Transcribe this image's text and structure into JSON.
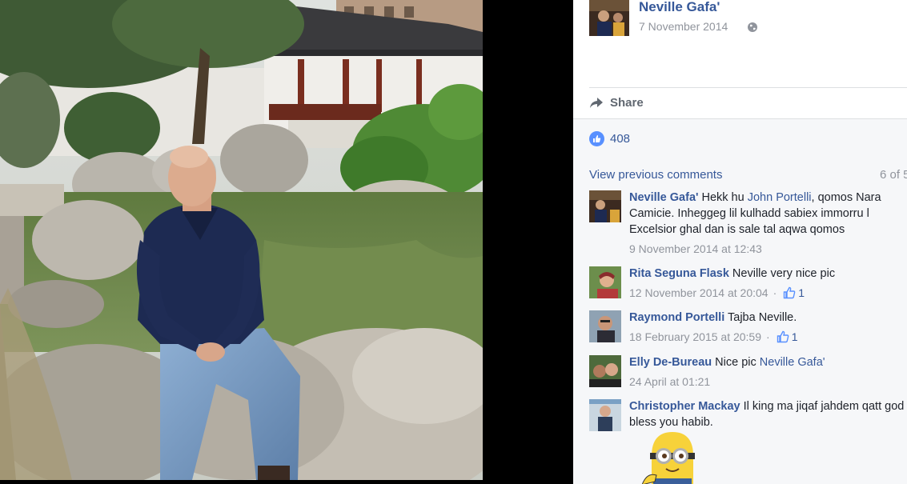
{
  "post": {
    "author": "Neville Gafa'",
    "date": "7 November 2014",
    "share_label": "Share",
    "likes_count": "408"
  },
  "comments": {
    "view_previous_label": "View previous comments",
    "count_label": "6 of 5",
    "items": [
      {
        "author": "Neville Gafa'",
        "text_before": " Hekk hu ",
        "link": "John Portelli",
        "text_after": ", qomos Nara Camicie. Inheggeg lil kulhadd sabiex immorru l Excelsior ghal dan is sale tal aqwa qomos",
        "timestamp": "9 November 2014 at 12:43"
      },
      {
        "author": "Rita Seguna Flask",
        "text_before": " Neville very nice pic",
        "timestamp": "12 November 2014 at 20:04",
        "likes": "1"
      },
      {
        "author": "Raymond Portelli",
        "text_before": " Tajba Neville.",
        "timestamp": "18 February 2015 at 20:59",
        "likes": "1"
      },
      {
        "author": "Elly De-Bureau",
        "text_before": " Nice pic ",
        "link": "Neville Gafa'",
        "timestamp": "24 April at 01:21"
      },
      {
        "author": "Christopher Mackay",
        "text_before": " Il king ma jiqaf jahdem qatt god bless you habib."
      }
    ]
  },
  "colors": {
    "link": "#365899",
    "meta": "#90949c",
    "like_blue": "#5890ff",
    "panel_gray": "#f6f7f9"
  },
  "icons": {
    "globe": "globe-icon",
    "share": "share-arrow-icon",
    "like": "thumbs-up-icon",
    "sticker": "minion-sticker"
  }
}
